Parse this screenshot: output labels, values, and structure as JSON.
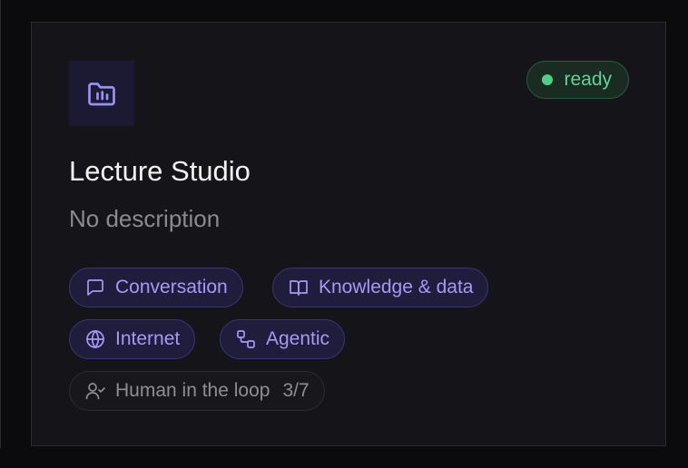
{
  "card": {
    "title": "Lecture Studio",
    "description": "No description",
    "status": {
      "label": "ready",
      "color": "#4fd08a"
    },
    "app_icon": "folder-chart-icon",
    "accent_color": "#a49af5",
    "capabilities": [
      {
        "label": "Conversation",
        "icon": "message-square-icon"
      },
      {
        "label": "Knowledge & data",
        "icon": "book-open-icon"
      },
      {
        "label": "Internet",
        "icon": "globe-icon"
      },
      {
        "label": "Agentic",
        "icon": "workflow-icon"
      }
    ],
    "human_in_loop": {
      "label": "Human in the loop",
      "count": "3/7",
      "icon": "user-check-icon"
    }
  }
}
